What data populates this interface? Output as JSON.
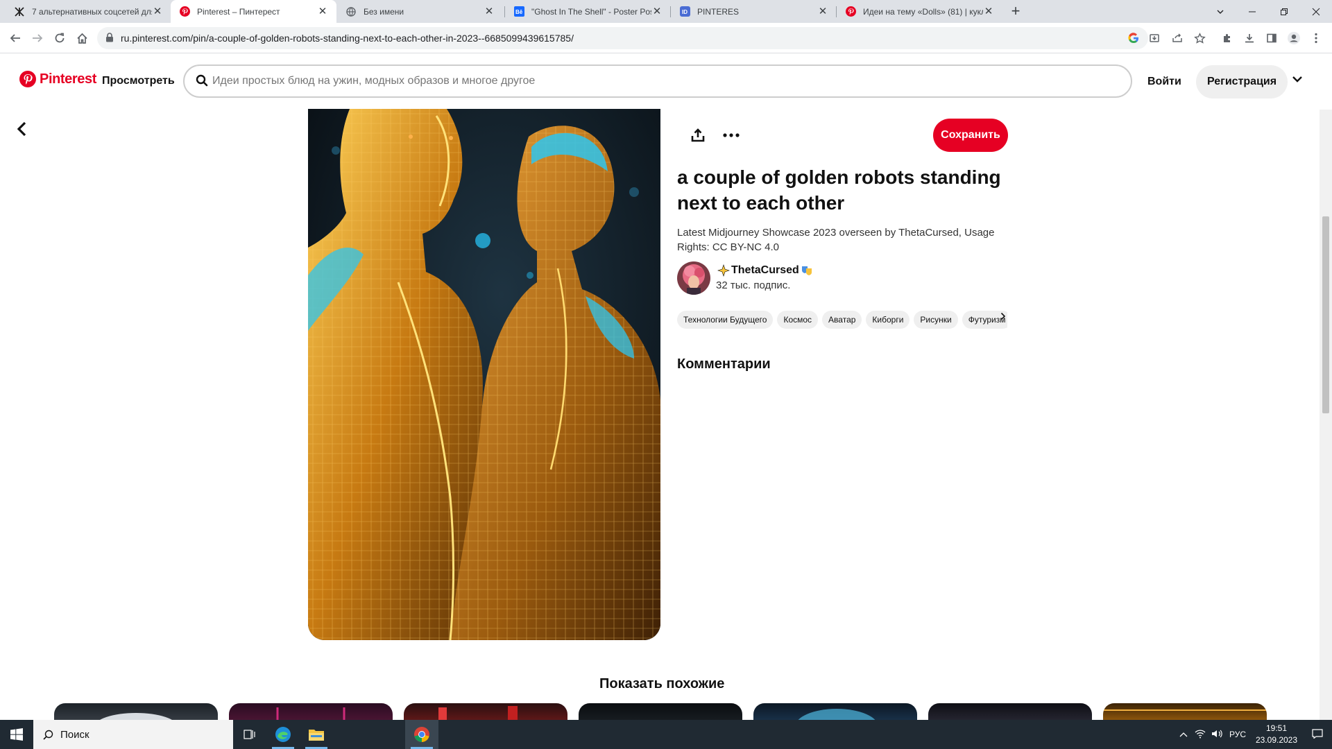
{
  "browser": {
    "tabs": [
      {
        "title": "7 альтернативных соцсетей для",
        "icon": "zhurnal-favicon-icon"
      },
      {
        "title": "Pinterest – Пинтерест",
        "icon": "pinterest-favicon-icon",
        "active": true
      },
      {
        "title": "Без имени",
        "icon": "globe-favicon-icon"
      },
      {
        "title": "\"Ghost In The Shell\" - Poster Pos",
        "icon": "behance-favicon-icon"
      },
      {
        "title": "PINTERES",
        "icon": "app-favicon-icon"
      },
      {
        "title": "Идеи на тему «Dolls» (81) | кукл",
        "icon": "pinterest-favicon-icon"
      }
    ],
    "url": "ru.pinterest.com/pin/a-couple-of-golden-robots-standing-next-to-each-other-in-2023--6685099439615785/"
  },
  "header": {
    "logo_text": "Pinterest",
    "explore_label": "Просмотреть",
    "search_placeholder": "Идеи простых блюд на ужин, модных образов и многое другое",
    "login_label": "Войти",
    "signup_label": "Регистрация"
  },
  "pin": {
    "save_label": "Сохранить",
    "title": "a couple of golden robots standing next to each other",
    "description": "Latest Midjourney Showcase 2023 overseen by ThetaCursed, Usage Rights: CC BY-NC 4.0",
    "author": {
      "name": "ThetaCursed",
      "followers": "32 тыс. подпис."
    },
    "tags": [
      "Технологии Будущего",
      "Космос",
      "Аватар",
      "Киборги",
      "Рисунки",
      "Футуризм"
    ],
    "comments_title": "Комментарии"
  },
  "similar": {
    "title": "Показать похожие"
  },
  "taskbar": {
    "search_label": "Поиск",
    "language": "РУС",
    "time": "19:51",
    "date": "23.09.2023"
  },
  "colors": {
    "brand": "#e60023",
    "tab_strip": "#dee1e6",
    "taskbar": "#202a33"
  }
}
